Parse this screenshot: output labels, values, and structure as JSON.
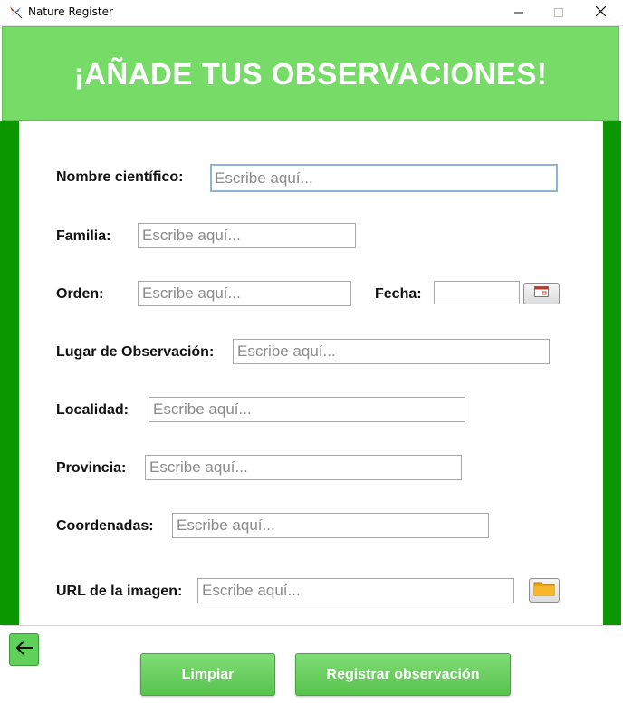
{
  "window": {
    "title": "Nature Register",
    "icon": "butterfly-icon"
  },
  "header": {
    "title": "¡AÑADE TUS OBSERVACIONES!"
  },
  "form": {
    "placeholder": "Escribe aquí...",
    "scientific_name_label": "Nombre científico:",
    "family_label": "Familia:",
    "order_label": "Orden:",
    "date_label": "Fecha:",
    "place_label": "Lugar de Observación:",
    "locality_label": "Localidad:",
    "province_label": "Provincia:",
    "coordinates_label": "Coordenadas:",
    "image_url_label": "URL de la imagen:",
    "date_value": "",
    "calendar_icon": "calendar-icon",
    "folder_icon": "folder-icon"
  },
  "footer": {
    "back_icon": "arrow-left-icon",
    "clear_label": "Limpiar",
    "register_label": "Registrar observación"
  },
  "colors": {
    "banner": "#76db67",
    "frame": "#0b9700",
    "button": "#5fc752"
  }
}
